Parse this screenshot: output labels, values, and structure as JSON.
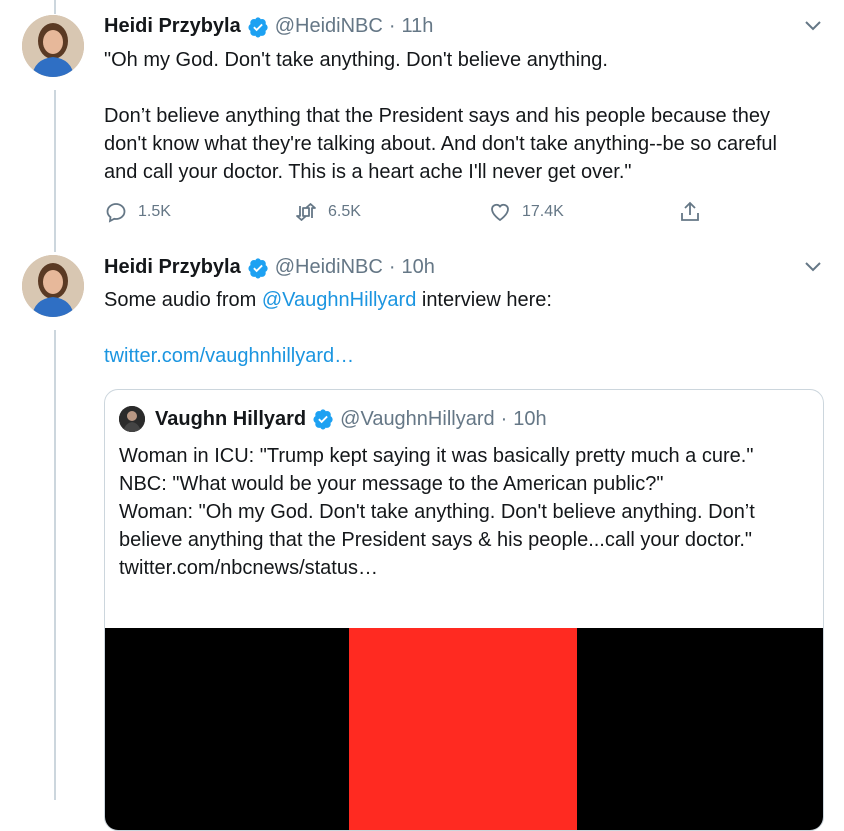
{
  "tweets": [
    {
      "name": "Heidi Przybyla",
      "handle": "@HeidiNBC",
      "separator": "·",
      "time": "11h",
      "text": "\"Oh my God. Don't take anything. Don't believe anything.\n\nDon’t believe anything that the President says and his people because they don't know what they're talking about. And don't take anything--be so careful and call your doctor. This is a heart ache I'll never get over.\"",
      "replies": "1.5K",
      "retweets": "6.5K",
      "likes": "17.4K"
    },
    {
      "name": "Heidi Przybyla",
      "handle": "@HeidiNBC",
      "separator": "·",
      "time": "10h",
      "text_prefix": "Some audio from ",
      "mention": "@VaughnHillyard",
      "text_suffix": " interview here:",
      "link": "twitter.com/vaughnhillyard…",
      "quote": {
        "name": "Vaughn Hillyard",
        "handle": "@VaughnHillyard",
        "separator": "·",
        "time": "10h",
        "text": "Woman in ICU: \"Trump kept saying it was basically pretty much a cure.\"\nNBC: \"What would be your message to the American public?\"\nWoman: \"Oh my God. Don't take anything. Don't believe anything. Don’t believe anything that the President says & his people...call your doctor.\" twitter.com/nbcnews/status…"
      }
    }
  ],
  "colors": {
    "link": "#1b95e0",
    "verified": "#1da1f2",
    "muted": "#657786",
    "media_red": "#ff2a21"
  }
}
